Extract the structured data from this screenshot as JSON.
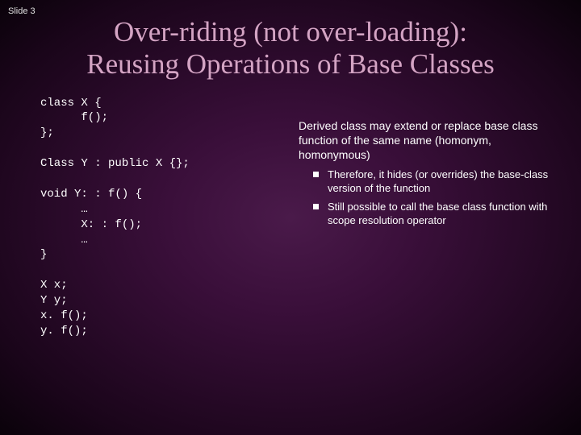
{
  "slide_number": "Slide 3",
  "title_line1": "Over-riding (not over-loading):",
  "title_line2": "Reusing Operations of Base Classes",
  "code": "class X {\n      f();\n};\n\nClass Y : public X {};\n\nvoid Y: : f() {\n      …\n      X: : f();\n      …\n}\n\nX x;\nY y;\nx. f();\ny. f();",
  "lead": "Derived class may extend or replace base class function of the same name (homonym, homonymous)",
  "bullets": [
    "Therefore, it hides (or overrides) the base-class version of the function",
    "Still possible to call the base class function with scope resolution operator"
  ]
}
